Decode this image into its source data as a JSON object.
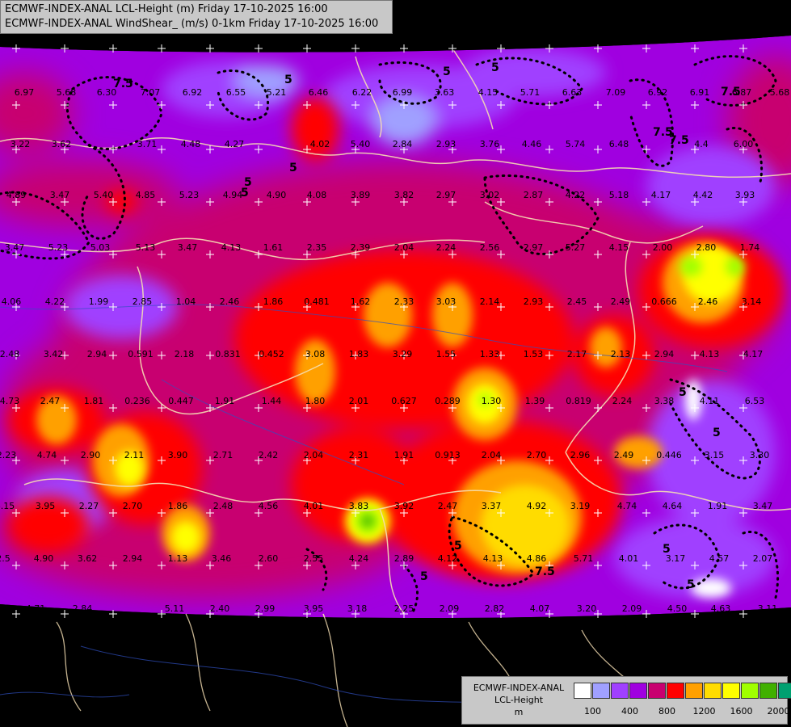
{
  "header": {
    "line1": "ECMWF-INDEX-ANAL LCL-Height (m) Friday 17-10-2025 16:00",
    "line2": "ECMWF-INDEX-ANAL WindShear_ (m/s) 0-1km Friday 17-10-2025 16:00"
  },
  "legend": {
    "model": "ECMWF-INDEX-ANAL",
    "field": "LCL-Height",
    "unit": "m",
    "colors": [
      "#ffffff",
      "#a0a0ff",
      "#a040ff",
      "#a000e0",
      "#c80070",
      "#ff0000",
      "#ffa000",
      "#ffdc00",
      "#ffff00",
      "#a0ff00",
      "#40b000",
      "#00a070",
      "#00a0ff"
    ],
    "ticks": [
      "100",
      "400",
      "800",
      "1200",
      "1600",
      "2000"
    ]
  },
  "map_labels": {
    "values": [
      "6.97",
      "5.68",
      "6.30",
      "7.07",
      "6.92",
      "6.55",
      "5.21",
      "6.46",
      "6.22",
      "6.99",
      "3.63",
      "4.15",
      "5.71",
      "6.63",
      "7.09",
      "6.92",
      "6.91",
      "6.87",
      "5.68",
      "3.22",
      "3.62",
      "3.71",
      "4.48",
      "4.27",
      "4.02",
      "5.40",
      "2.84",
      "2.93",
      "3.76",
      "4.46",
      "5.74",
      "6.48",
      "4.4",
      "6.00",
      "4.89",
      "3.47",
      "5.40",
      "4.85",
      "5.23",
      "4.94",
      "4.90",
      "4.08",
      "3.89",
      "3.82",
      "2.97",
      "3.02",
      "2.87",
      "4.22",
      "5.18",
      "4.17",
      "4.42",
      "3.93",
      "3.47",
      "5.23",
      "5.03",
      "5.13",
      "3.47",
      "4.13",
      "1.61",
      "2.35",
      "2.39",
      "2.04",
      "2.24",
      "2.56",
      "2.97",
      "5.27",
      "4.15",
      "2.00",
      "2.80",
      "1.74",
      "4.06",
      "4.22",
      "1.99",
      "2.85",
      "1.04",
      "2.46",
      "1.86",
      "0.481",
      "1.62",
      "2.33",
      "3.03",
      "2.14",
      "2.93",
      "2.45",
      "2.49",
      "0.666",
      "2.46",
      "3.14",
      "2.48",
      "3.42",
      "2.94",
      "0.591",
      "2.18",
      "0.831",
      "0.452",
      "3.08",
      "1.83",
      "3.29",
      "1.55",
      "1.33",
      "1.53",
      "2.17",
      "2.13",
      "2.94",
      "4.13",
      "4.17",
      "4.73",
      "2.47",
      "1.81",
      "0.236",
      "0.447",
      "1.91",
      "1.44",
      "1.80",
      "2.01",
      "0.627",
      "0.289",
      "1.30",
      "1.39",
      "0.819",
      "2.24",
      "3.38",
      "4.11",
      "6.53",
      "2.23",
      "4.74",
      "2.90",
      "2.11",
      "3.90",
      "2.71",
      "2.42",
      "2.04",
      "2.31",
      "1.91",
      "0.913",
      "2.04",
      "2.70",
      "2.96",
      "2.49",
      "0.446",
      "3.15",
      "3.30",
      "4.15",
      "3.95",
      "2.27",
      "2.70",
      "1.86",
      "2.48",
      "4.56",
      "4.01",
      "3.83",
      "3.92",
      "2.47",
      "3.37",
      "4.92",
      "3.19",
      "4.74",
      "4.64",
      "1.91",
      "3.47",
      "2.5",
      "4.90",
      "3.62",
      "2.94",
      "1.13",
      "3.46",
      "2.60",
      "2.55",
      "4.24",
      "2.89",
      "4.12",
      "4.13",
      "4.86",
      "5.71",
      "4.01",
      "3.17",
      "4.57",
      "2.07",
      "4.71",
      "2.84",
      "5.11",
      "2.40",
      "2.99",
      "3.95",
      "3.18",
      "2.25",
      "2.09",
      "2.82",
      "4.07",
      "3.20",
      "2.09",
      "4.50",
      "4.63",
      "3.11",
      "3.92"
    ],
    "contours": [
      "7.5",
      "5",
      "5",
      "5",
      "7.5",
      "7.5",
      "5",
      "5",
      "7.5",
      "5",
      "5",
      "5",
      "7.5",
      "5",
      "5",
      "5",
      "5"
    ]
  }
}
